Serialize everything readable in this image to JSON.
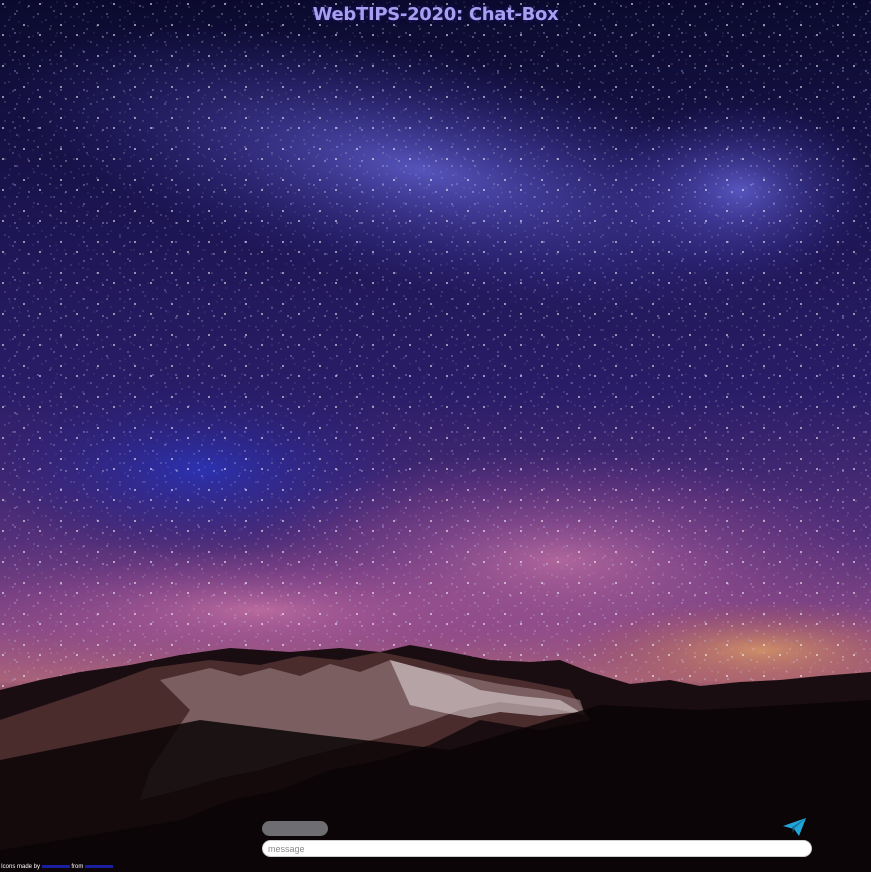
{
  "header": {
    "title": "WebTIPS-2020: Chat-Box"
  },
  "composer": {
    "name_label": "",
    "message_placeholder": "message",
    "message_value": "",
    "send_icon": "paper-plane-icon"
  },
  "attribution": {
    "prefix": "Icons made by",
    "author_link": "",
    "middle": "from",
    "source_link": ""
  },
  "background": {
    "scene": "starry-night-sky-over-mountains"
  },
  "colors": {
    "title": "#a6a0f0",
    "send_icon": "#22a6d8",
    "name_pill": "#6d6d72",
    "input_bg": "#ffffff"
  }
}
